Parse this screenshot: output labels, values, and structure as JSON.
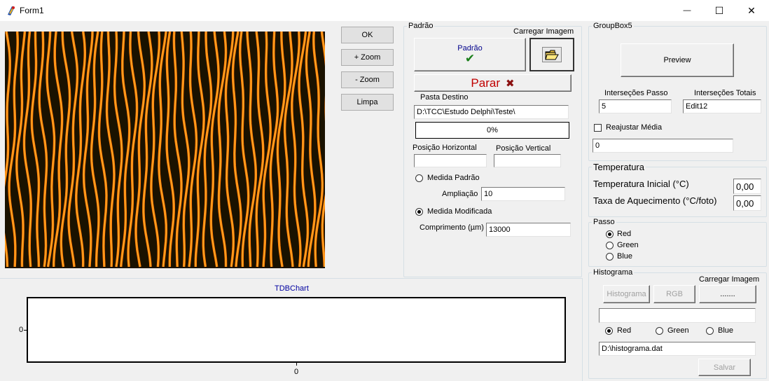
{
  "window": {
    "title": "Form1",
    "minimize_glyph": "—",
    "maximize_glyph": "☐",
    "close_glyph": "✕"
  },
  "toolbar": {
    "ok": "OK",
    "zoom_in": "+ Zoom",
    "zoom_out": "- Zoom",
    "clear": "Limpa"
  },
  "padrao": {
    "caption": "Padrão",
    "load_image_label": "Carregar Imagem",
    "padrao_button": "Padrão",
    "check_glyph": "✔",
    "stop_button": "Parar",
    "stop_glyph": "✖",
    "folder_label": "Pasta Destino",
    "folder_value": "D:\\TCC\\Estudo Delphi\\Teste\\",
    "progress_text": "0%",
    "progress": 0,
    "horiz_label": "Posição Horizontal",
    "horiz_value": "",
    "vert_label": "Posição Vertical",
    "vert_value": "",
    "medida_padrao_label": "Medida Padrão",
    "ampliacao_label": "Ampliação",
    "ampliacao_value": "10",
    "medida_modificada_label": "Medida Modificada",
    "comprimento_label": "Comprimento (µm)",
    "comprimento_value": "13000"
  },
  "chart": {
    "title": "TDBChart",
    "y_tick": "0",
    "x_tick": "0"
  },
  "chart_data": {
    "type": "line",
    "title": "TDBChart",
    "xlabel": "",
    "ylabel": "",
    "x_ticks": [
      "0"
    ],
    "y_ticks": [
      "0"
    ],
    "series": []
  },
  "groupbox5": {
    "caption": "GroupBox5",
    "preview_button": "Preview",
    "intersec_passo_label": "Interseções Passo",
    "intersec_passo_value": "5",
    "intersec_totais_label": "Interseções Totais",
    "intersec_totais_value": "Edit12",
    "reajustar_label": "Reajustar Média",
    "reajustar_value": "0"
  },
  "temperatura": {
    "caption": "Temperatura",
    "inicial_label": "Temperatura Inicial (°C)",
    "inicial_value": "0,00",
    "taxa_label": "Taxa de Aquecimento (°C/foto)",
    "taxa_value": "0,00"
  },
  "passo": {
    "caption": "Passo",
    "options": [
      "Red",
      "Green",
      "Blue"
    ],
    "selected": "Red"
  },
  "histograma": {
    "caption": "Histograma",
    "load_image_label": "Carregar Imagem",
    "histograma_button": "Histograma",
    "rgb_button": "RGB",
    "dots_button": ".......",
    "blank_value": "",
    "options": [
      "Red",
      "Green",
      "Blue"
    ],
    "selected": "Red",
    "file_value": "D:\\histograma.dat",
    "save_button": "Salvar"
  },
  "colors": {
    "fringe_dark": "#1a1200",
    "fringe_orange": "#ff7a00",
    "fringe_yellow": "#ffc040",
    "stop_red": "#c00000",
    "check_green": "#1a7f1a",
    "chart_title_blue": "#0000a0"
  }
}
